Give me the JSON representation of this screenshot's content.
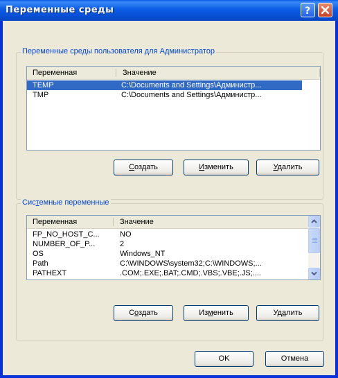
{
  "window": {
    "title": "Переменные среды"
  },
  "user_vars": {
    "group_label": "Переменные среды пользователя для Администратор",
    "columns": [
      "Переменная",
      "Значение"
    ],
    "rows": [
      {
        "name": "TEMP",
        "value": "C:\\Documents and Settings\\Администр...",
        "selected": true
      },
      {
        "name": "TMP",
        "value": "C:\\Documents and Settings\\Администр...",
        "selected": false
      }
    ],
    "buttons": {
      "create": {
        "mnemonic": "С",
        "rest": "оздать"
      },
      "edit": {
        "mnemonic": "И",
        "rest": "зменить"
      },
      "delete": {
        "mnemonic": "У",
        "rest": "далить"
      }
    }
  },
  "system_vars": {
    "group_label_pre": "Сис",
    "group_label_mnemonic": "т",
    "group_label_post": "емные переменные",
    "columns": [
      "Переменная",
      "Значение"
    ],
    "rows": [
      {
        "name": "FP_NO_HOST_C...",
        "value": "NO"
      },
      {
        "name": "NUMBER_OF_P...",
        "value": "2"
      },
      {
        "name": "OS",
        "value": "Windows_NT"
      },
      {
        "name": "Path",
        "value": "C:\\WINDOWS\\system32;C:\\WINDOWS;..."
      },
      {
        "name": "PATHEXT",
        "value": ".COM;.EXE;.BAT;.CMD;.VBS;.VBE;.JS;...."
      }
    ],
    "buttons": {
      "create": {
        "pre": "С",
        "mnemonic": "о",
        "rest": "здать"
      },
      "edit": {
        "pre": "Из",
        "mnemonic": "м",
        "rest": "енить"
      },
      "delete": {
        "pre": "Уд",
        "mnemonic": "а",
        "rest": "лить"
      }
    }
  },
  "footer": {
    "ok": "OK",
    "cancel": "Отмена"
  },
  "colors": {
    "titlebar": "#0a5ce6",
    "client": "#ece9d8",
    "selection": "#316ac5",
    "group_label": "#0046d5"
  }
}
